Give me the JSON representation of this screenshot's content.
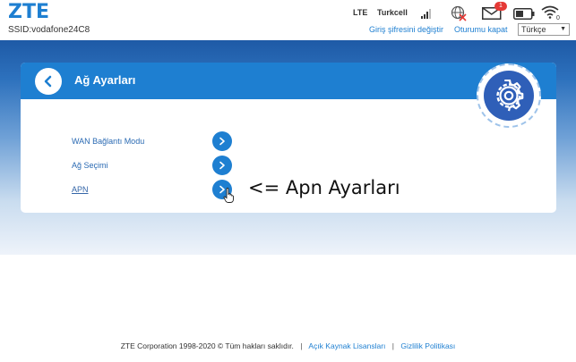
{
  "header": {
    "logo": "ZTE",
    "ssid": "SSID:vodafone24C8",
    "network_type": "LTE",
    "operator": "Turkcell",
    "mail_count": "1",
    "link_change_password": "Giriş şifresini değiştir",
    "link_logout": "Oturumu kapat",
    "language_selected": "Türkçe",
    "icons": [
      "signal-icon",
      "globe-disconnected-icon",
      "mail-icon",
      "battery-icon",
      "wifi-icon"
    ]
  },
  "card": {
    "title": "Ağ Ayarları",
    "items": [
      {
        "label": "WAN Bağlantı Modu"
      },
      {
        "label": "Ağ Seçimi"
      },
      {
        "label": "APN"
      }
    ]
  },
  "annotation": "<= Apn Ayarları",
  "footer": {
    "copyright": "ZTE Corporation 1998-2020 © Tüm hakları saklıdır.",
    "sep1": "|",
    "link_open_source": "Açık Kaynak Lisansları",
    "sep2": "|",
    "link_privacy": "Gizlilik Politikası"
  },
  "colors": {
    "brand": "#1e7fd1",
    "gear_badge": "#2f5fb8",
    "badge_red": "#e53935"
  }
}
